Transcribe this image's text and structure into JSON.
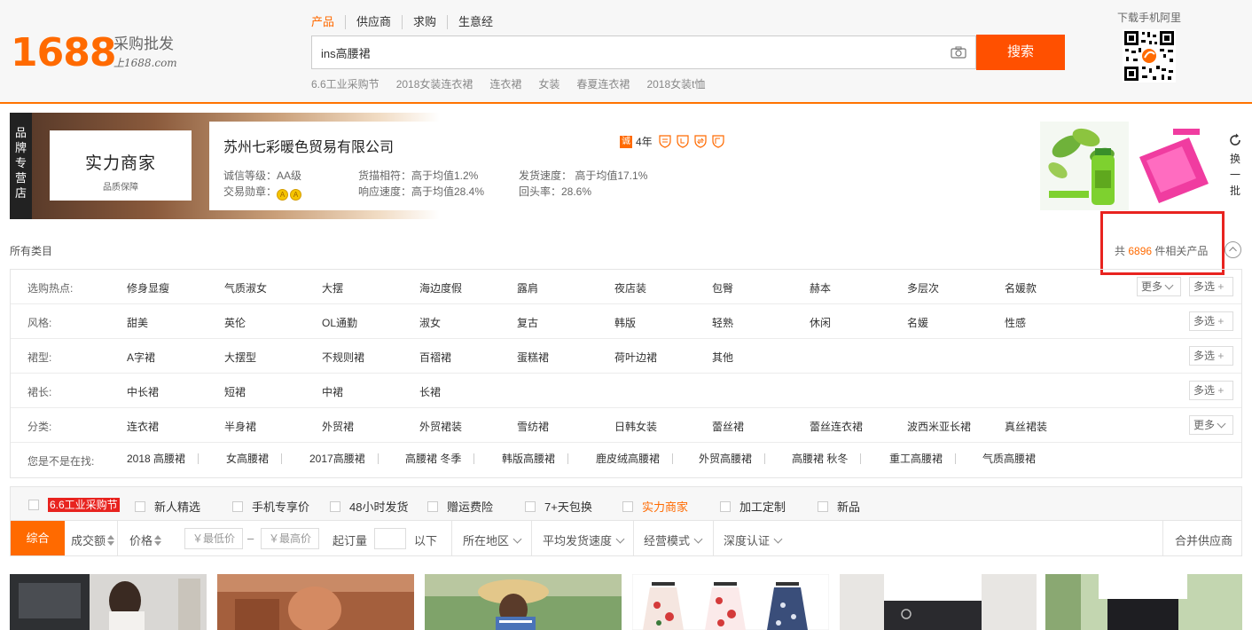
{
  "logo": {
    "number": "1688",
    "slogan": "采购批发",
    "site": "上1688.com"
  },
  "search": {
    "tabs": [
      "产品",
      "供应商",
      "求购",
      "生意经"
    ],
    "active_tab": 0,
    "query": "ins高腰裙",
    "button": "搜索",
    "hotwords": [
      "6.6工业采购节",
      "2018女装连衣裙",
      "连衣裙",
      "女装",
      "春夏连衣裙",
      "2018女装t恤"
    ]
  },
  "mobile": {
    "label": "下载手机阿里"
  },
  "brand": {
    "tag": "品牌专营店",
    "logo_title": "实力商家",
    "logo_sub": "品质保障",
    "company": "苏州七彩暖色贸易有限公司",
    "years": "4年",
    "badge_cheng": "诚",
    "metrics": [
      "诚信等级：AA级",
      "货描相符：高于均值1.2%",
      "发货速度： 高于均值17.1%",
      "交易勋章：",
      "响应速度：高于均值28.4%",
      "回头率：28.6%"
    ],
    "refresh": "换一批"
  },
  "results": {
    "all_categories": "所有类目",
    "prefix": "共",
    "count": "6896",
    "suffix": "件相关产品"
  },
  "filters": {
    "hot": {
      "label": "选购热点:",
      "items": [
        "修身显瘦",
        "气质淑女",
        "大摆",
        "海边度假",
        "露肩",
        "夜店装",
        "包臀",
        "赫本",
        "多层次",
        "名媛款"
      ]
    },
    "style": {
      "label": "风格:",
      "items": [
        "甜美",
        "英伦",
        "OL通勤",
        "淑女",
        "复古",
        "韩版",
        "轻熟",
        "休闲",
        "名媛",
        "性感"
      ]
    },
    "shape": {
      "label": "裙型:",
      "items": [
        "A字裙",
        "大摆型",
        "不规则裙",
        "百褶裙",
        "蛋糕裙",
        "荷叶边裙",
        "其他"
      ]
    },
    "length": {
      "label": "裙长:",
      "items": [
        "中长裙",
        "短裙",
        "中裙",
        "长裙"
      ]
    },
    "category": {
      "label": "分类:",
      "items": [
        "连衣裙",
        "半身裙",
        "外贸裙",
        "外贸裙装",
        "雪纺裙",
        "日韩女装",
        "蕾丝裙",
        "蕾丝连衣裙",
        "波西米亚长裙",
        "真丝裙装"
      ]
    },
    "suggest": {
      "label": "您是不是在找:",
      "items": [
        "2018 高腰裙",
        "女高腰裙",
        "2017高腰裙",
        "高腰裙 冬季",
        "韩版高腰裙",
        "鹿皮绒高腰裙",
        "外贸高腰裙",
        "高腰裙 秋冬",
        "重工高腰裙",
        "气质高腰裙"
      ]
    },
    "more": "更多",
    "multi": "多选"
  },
  "options": [
    "6.6工业采购节",
    "新人精选",
    "手机专享价",
    "48小时发货",
    "赠运费险",
    "7+天包换",
    "实力商家",
    "加工定制",
    "新品"
  ],
  "sort": {
    "default": "综合",
    "volume": "成交额",
    "price": "价格",
    "min_price": "￥最低价",
    "dash": "–",
    "max_price": "￥最高价",
    "moq": "起订量",
    "moq_suffix": "以下",
    "location": "所在地区",
    "ship_speed": "平均发货速度",
    "mode": "经营模式",
    "auth": "深度认证",
    "merge": "合并供应商"
  },
  "colors": {
    "brand": "#ff6a00",
    "search_button": "#ff5000",
    "highlight": "#e8231f"
  }
}
